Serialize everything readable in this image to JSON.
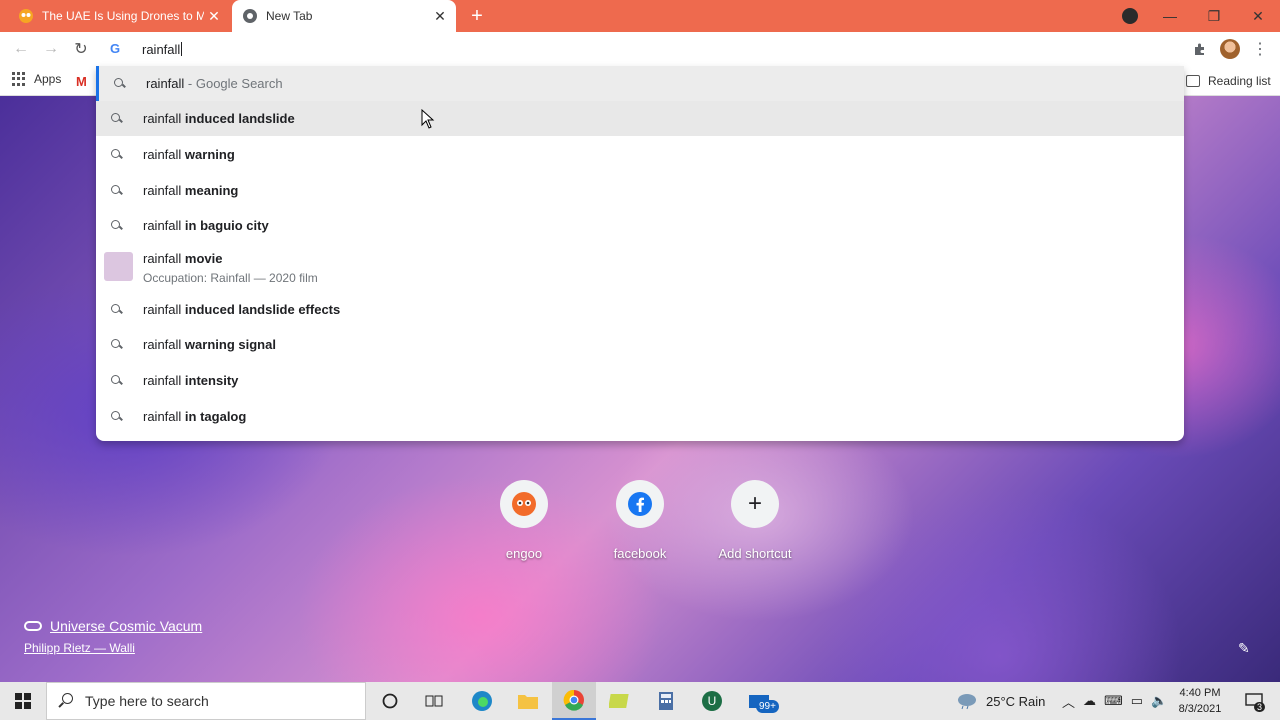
{
  "browser": {
    "tabs": [
      {
        "title": "The UAE Is Using Drones to Make",
        "active": false
      },
      {
        "title": "New Tab",
        "active": true
      }
    ],
    "omnibox": {
      "value": "rainfall"
    },
    "bookmarks": {
      "apps_label": "Apps",
      "reading_list_label": "Reading list"
    }
  },
  "suggestions": [
    {
      "prefix": "rainfall",
      "suffix": "",
      "extra": "- Google Search",
      "state": "selected"
    },
    {
      "prefix": "rainfall",
      "suffix": "induced landslide",
      "extra": "",
      "state": "hover"
    },
    {
      "prefix": "rainfall",
      "suffix": "warning",
      "extra": ""
    },
    {
      "prefix": "rainfall",
      "suffix": "meaning",
      "extra": ""
    },
    {
      "prefix": "rainfall",
      "suffix": "in baguio city",
      "extra": ""
    },
    {
      "prefix": "rainfall",
      "suffix": "induced landslide effects",
      "extra": ""
    },
    {
      "prefix": "rainfall",
      "suffix": "warning signal",
      "extra": ""
    },
    {
      "prefix": "rainfall",
      "suffix": "intensity",
      "extra": ""
    },
    {
      "prefix": "rainfall",
      "suffix": "in tagalog",
      "extra": ""
    }
  ],
  "movie_suggestion": {
    "prefix": "rainfall",
    "suffix": "movie",
    "subtitle": "Occupation: Rainfall — 2020 film"
  },
  "shortcuts": [
    {
      "label": "engoo",
      "icon": "engoo-icon"
    },
    {
      "label": "facebook",
      "icon": "facebook-icon"
    },
    {
      "label": "Add shortcut",
      "icon": "plus-icon"
    }
  ],
  "attribution": {
    "title": "Universe Cosmic Vacum",
    "author": "Philipp Rietz — Walli"
  },
  "taskbar": {
    "search_placeholder": "Type here to search",
    "weather": "25°C  Rain",
    "mail_badge": "99+",
    "time": "4:40 PM",
    "date": "8/3/2021",
    "notifications": "3"
  },
  "colors": {
    "tabstrip": "#ee6a4e",
    "accent": "#1a73e8"
  }
}
